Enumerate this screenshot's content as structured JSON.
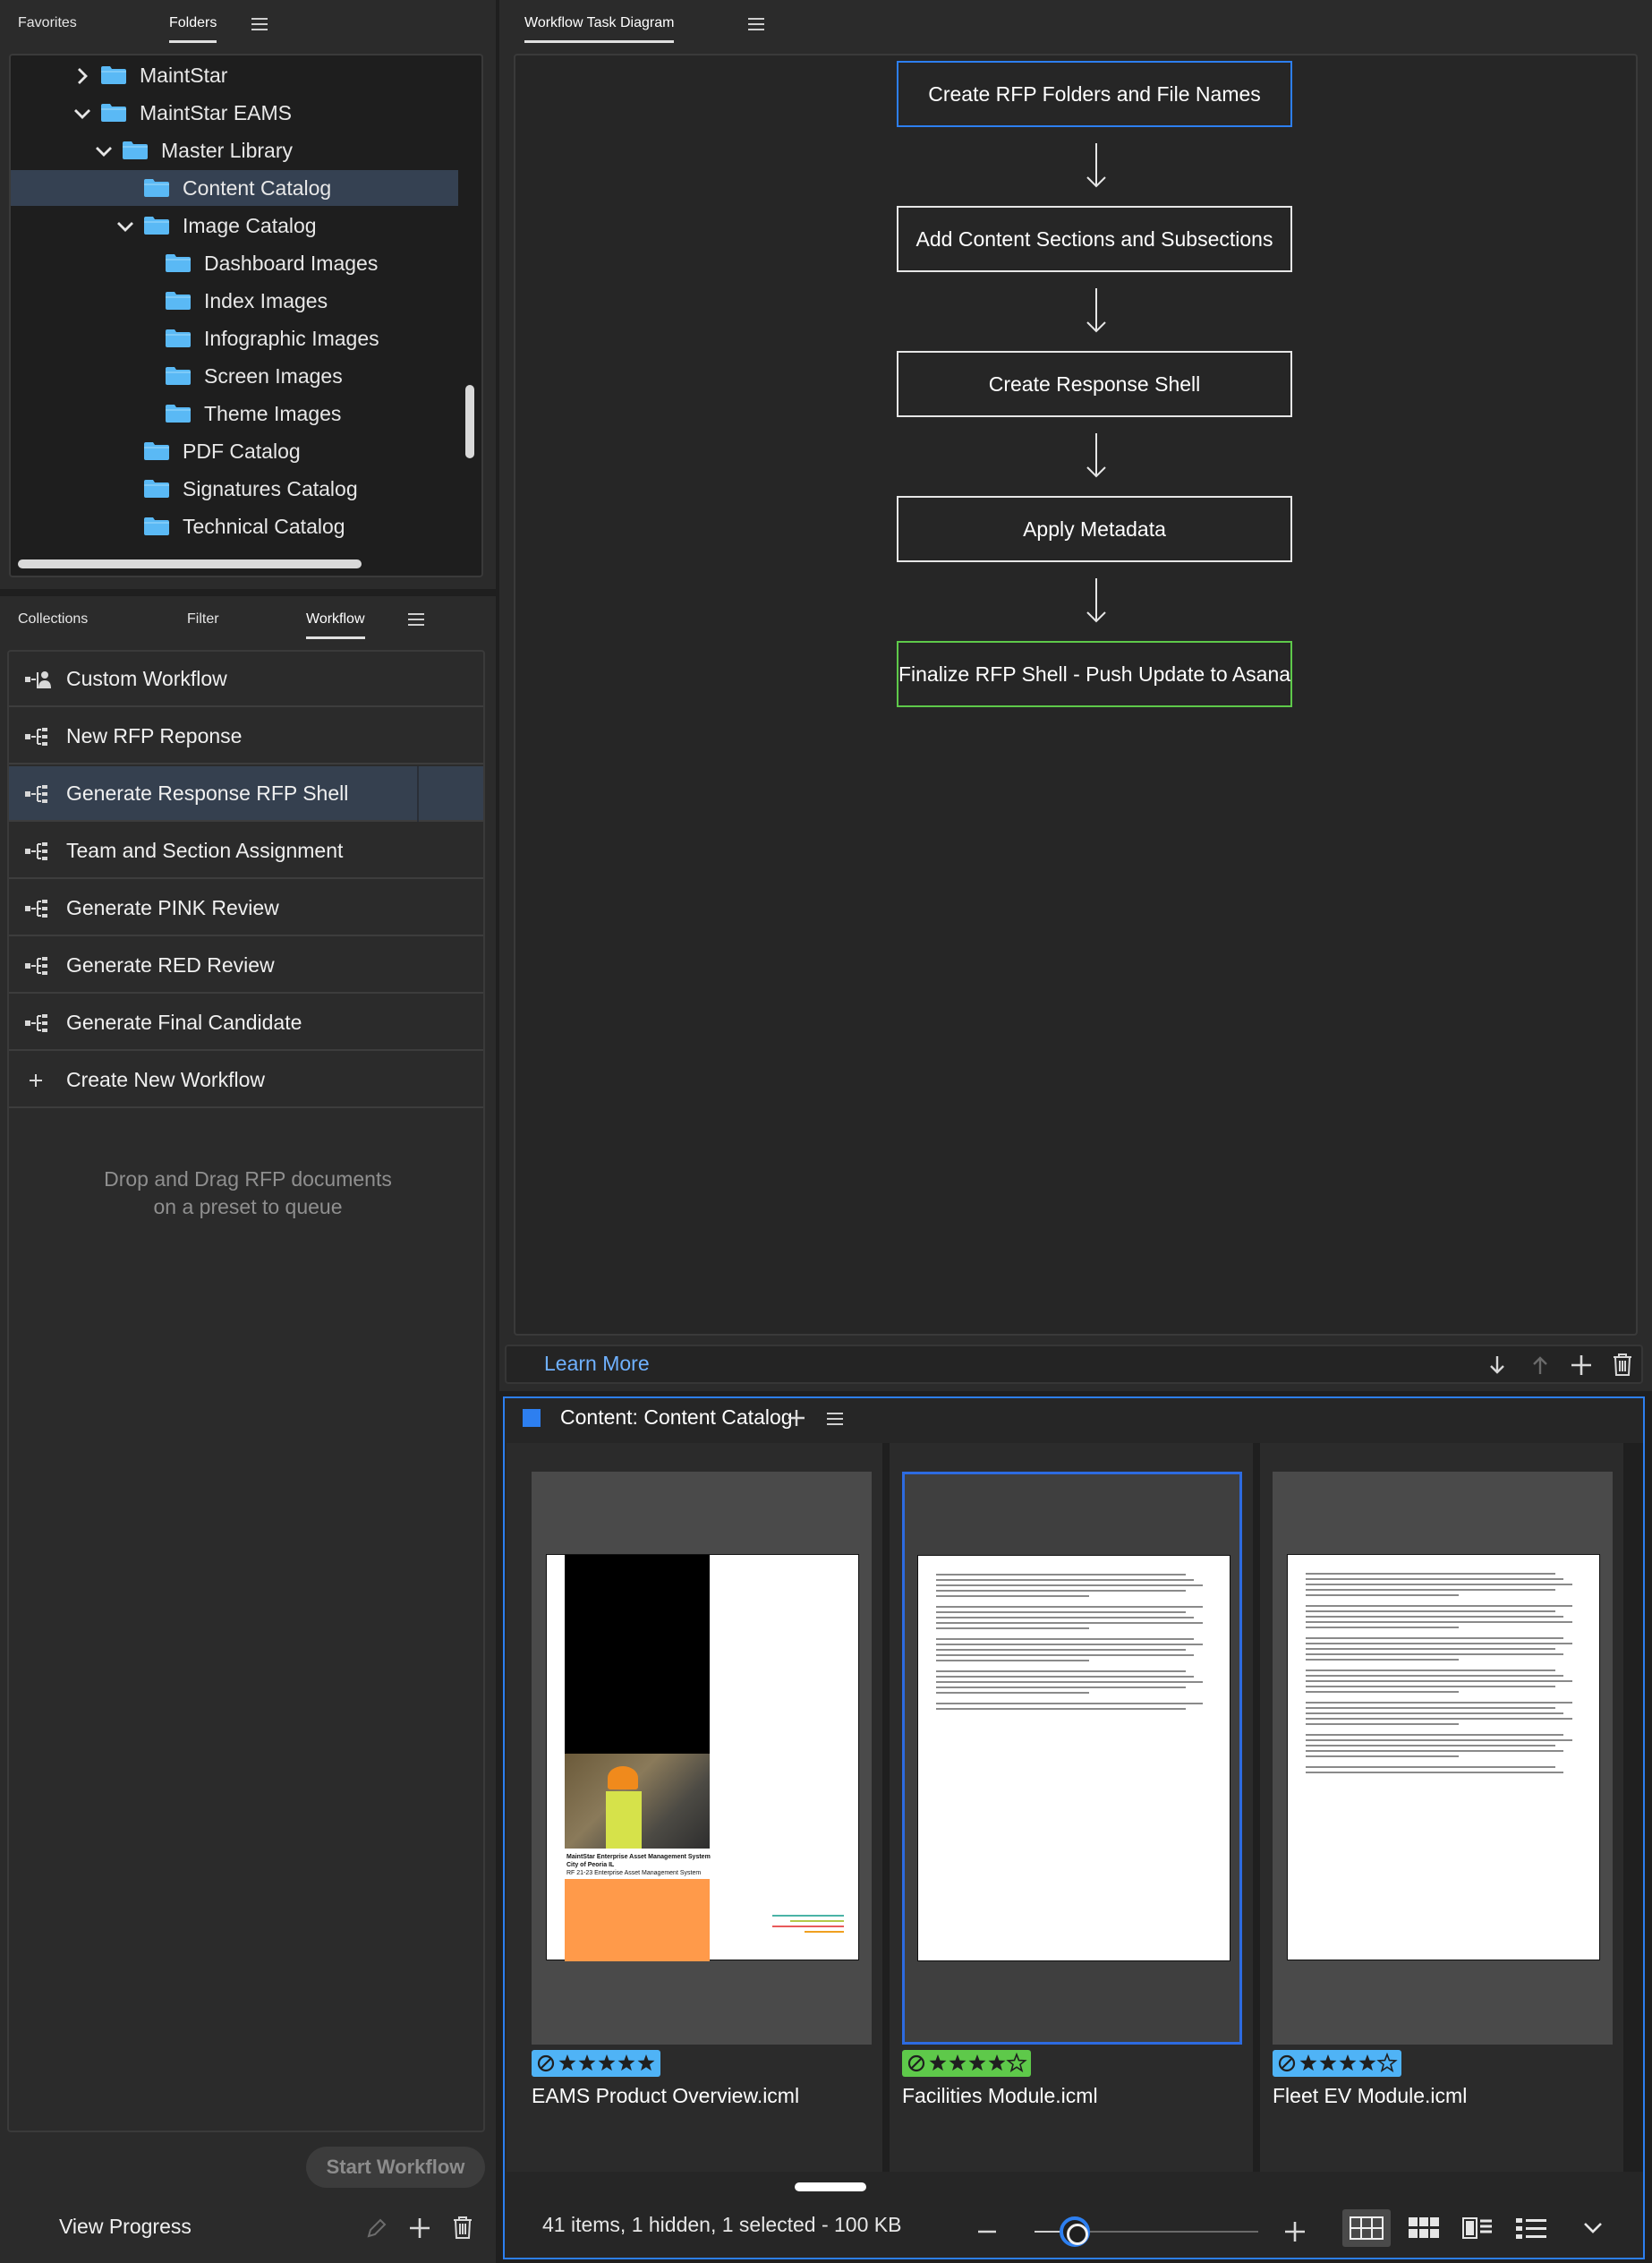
{
  "folders_panel": {
    "tabs": [
      "Favorites",
      "Folders"
    ],
    "active_tab": "Folders",
    "tree": [
      {
        "label": "MaintStar",
        "level": 0,
        "expander": "collapsed"
      },
      {
        "label": "MaintStar EAMS",
        "level": 0,
        "expander": "expanded"
      },
      {
        "label": "Master Library",
        "level": 1,
        "expander": "expanded"
      },
      {
        "label": "Content Catalog",
        "level": 2,
        "expander": "none",
        "selected": true
      },
      {
        "label": "Image Catalog",
        "level": 2,
        "expander": "expanded"
      },
      {
        "label": "Dashboard Images",
        "level": 3,
        "expander": "none"
      },
      {
        "label": "Index Images",
        "level": 3,
        "expander": "none"
      },
      {
        "label": "Infographic Images",
        "level": 3,
        "expander": "none"
      },
      {
        "label": "Screen Images",
        "level": 3,
        "expander": "none"
      },
      {
        "label": "Theme Images",
        "level": 3,
        "expander": "none"
      },
      {
        "label": "PDF Catalog",
        "level": 2,
        "expander": "none"
      },
      {
        "label": "Signatures Catalog",
        "level": 2,
        "expander": "none"
      },
      {
        "label": "Technical Catalog",
        "level": 2,
        "expander": "none"
      }
    ]
  },
  "workflow_panel": {
    "tabs": [
      "Collections",
      "Filter",
      "Workflow"
    ],
    "active_tab": "Workflow",
    "presets": [
      {
        "label": "Custom Workflow",
        "icon": "custom-workflow-icon"
      },
      {
        "label": "New RFP Reponse",
        "icon": "workflow-icon"
      },
      {
        "label": "Generate Response RFP Shell",
        "icon": "workflow-icon",
        "selected": true
      },
      {
        "label": "Team and Section Assignment",
        "icon": "workflow-icon"
      },
      {
        "label": "Generate PINK Review",
        "icon": "workflow-icon"
      },
      {
        "label": "Generate RED Review",
        "icon": "workflow-icon"
      },
      {
        "label": "Generate Final Candidate",
        "icon": "workflow-icon"
      },
      {
        "label": "Create New Workflow",
        "icon": "plus-icon"
      }
    ],
    "drop_hint_line1": "Drop and Drag RFP documents",
    "drop_hint_line2": "on a preset to queue",
    "start_button": "Start Workflow",
    "view_progress": "View Progress"
  },
  "diagram_panel": {
    "title": "Workflow Task Diagram",
    "steps": [
      {
        "label": "Create RFP Folders and File Names",
        "border": "#2d7ff0"
      },
      {
        "label": "Add Content Sections and Subsections",
        "border": "#e6e6e6"
      },
      {
        "label": "Create Response Shell",
        "border": "#e6e6e6"
      },
      {
        "label": "Apply Metadata",
        "border": "#e6e6e6"
      },
      {
        "label": "Finalize RFP Shell - Push Update to Asana",
        "border": "#5ec94a"
      }
    ],
    "learn_more": "Learn More"
  },
  "content_panel": {
    "title": "Content: Content Catalog",
    "items": [
      {
        "filename": "EAMS Product Overview.icml",
        "stars": 5,
        "label_color": "#4fb3f6",
        "selected": false
      },
      {
        "filename": "Facilities Module.icml",
        "stars": 4,
        "label_color": "#5ec94a",
        "selected": true
      },
      {
        "filename": "Fleet EV Module.icml",
        "stars": 4,
        "label_color": "#4fb3f6",
        "selected": false
      }
    ],
    "cover_page": {
      "heading": "MaintStar Enterprise Asset Management System",
      "line2": "City of Peoria IL",
      "line3": "RF 21-23 Enterprise Asset Management System"
    },
    "status": "41 items, 1 hidden, 1 selected - 100 KB",
    "zoom_fraction": 0.18
  },
  "colors": {
    "accent_blue": "#2d7ff0",
    "link_blue": "#6fb1ff",
    "label_blue": "#4fb3f6",
    "label_green": "#5ec94a"
  }
}
